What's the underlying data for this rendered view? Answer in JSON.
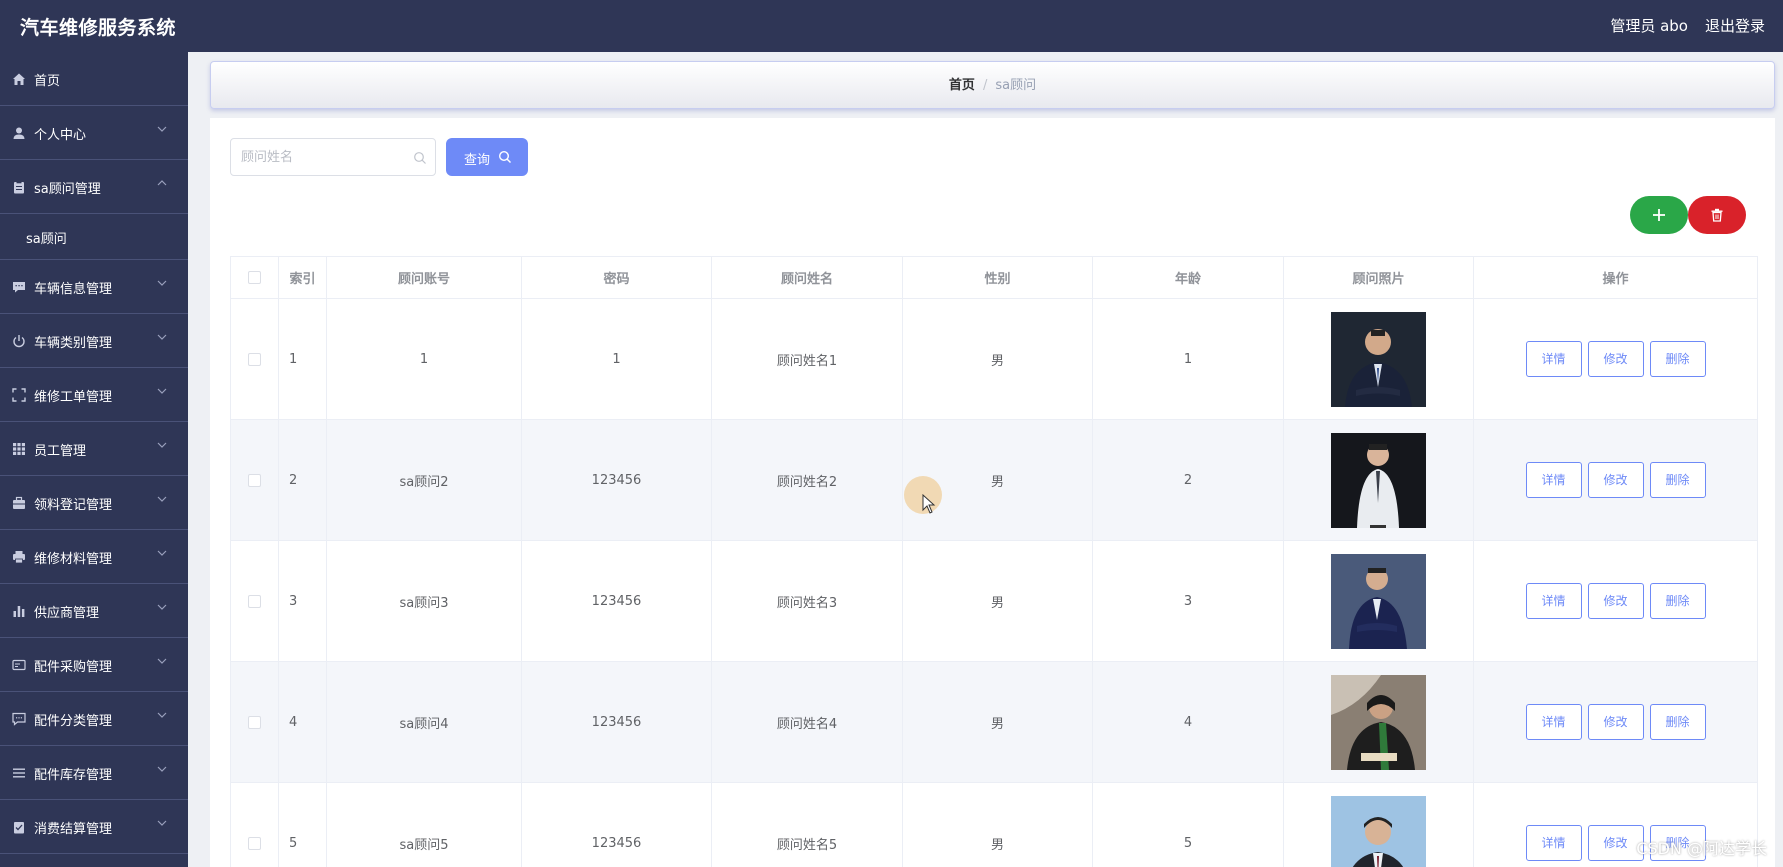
{
  "header": {
    "app_title": "汽车维修服务系统",
    "admin": "管理员 abo",
    "logout": "退出登录"
  },
  "sidebar": {
    "items": [
      {
        "label": "首页",
        "icon": "home-icon",
        "expandable": false
      },
      {
        "label": "个人中心",
        "icon": "user-icon",
        "expandable": true
      },
      {
        "label": "sa顾问管理",
        "icon": "clipboard-icon",
        "expandable": true,
        "expanded": true
      },
      {
        "label": "sa顾问",
        "icon": "",
        "sub": true
      },
      {
        "label": "车辆信息管理",
        "icon": "chat-icon",
        "expandable": true
      },
      {
        "label": "车辆类别管理",
        "icon": "power-icon",
        "expandable": true
      },
      {
        "label": "维修工单管理",
        "icon": "fullscreen-icon",
        "expandable": true
      },
      {
        "label": "员工管理",
        "icon": "grid-icon",
        "expandable": true
      },
      {
        "label": "领料登记管理",
        "icon": "briefcase-icon",
        "expandable": true
      },
      {
        "label": "维修材料管理",
        "icon": "printer-icon",
        "expandable": true
      },
      {
        "label": "供应商管理",
        "icon": "bar-chart-icon",
        "expandable": true
      },
      {
        "label": "配件采购管理",
        "icon": "card-icon",
        "expandable": true
      },
      {
        "label": "配件分类管理",
        "icon": "message-icon",
        "expandable": true
      },
      {
        "label": "配件库存管理",
        "icon": "list-icon",
        "expandable": true
      },
      {
        "label": "消费结算管理",
        "icon": "checklist-icon",
        "expandable": true
      }
    ]
  },
  "breadcrumb": {
    "home": "首页",
    "separator": "/",
    "current": "sa顾问"
  },
  "search": {
    "placeholder": "顾问姓名",
    "value": "",
    "query_label": "查询"
  },
  "table": {
    "columns": [
      "索引",
      "顾问账号",
      "密码",
      "顾问姓名",
      "性别",
      "年龄",
      "顾问照片",
      "操作"
    ],
    "actions": {
      "detail": "详情",
      "edit": "修改",
      "delete": "删除"
    },
    "rows": [
      {
        "index": "1",
        "account": "1",
        "password": "1",
        "name": "顾问姓名1",
        "gender": "男",
        "age": "1"
      },
      {
        "index": "2",
        "account": "sa顾问2",
        "password": "123456",
        "name": "顾问姓名2",
        "gender": "男",
        "age": "2"
      },
      {
        "index": "3",
        "account": "sa顾问3",
        "password": "123456",
        "name": "顾问姓名3",
        "gender": "男",
        "age": "3"
      },
      {
        "index": "4",
        "account": "sa顾问4",
        "password": "123456",
        "name": "顾问姓名4",
        "gender": "男",
        "age": "4"
      },
      {
        "index": "5",
        "account": "sa顾问5",
        "password": "123456",
        "name": "顾问姓名5",
        "gender": "男",
        "age": "5"
      }
    ]
  },
  "watermark": "CSDN @阿达学长",
  "colors": {
    "header_bg": "#2f3656",
    "sidebar_bg": "#2f3656",
    "primary": "#6e8af7",
    "add_green": "#2aa748",
    "delete_red": "#d9222a"
  }
}
